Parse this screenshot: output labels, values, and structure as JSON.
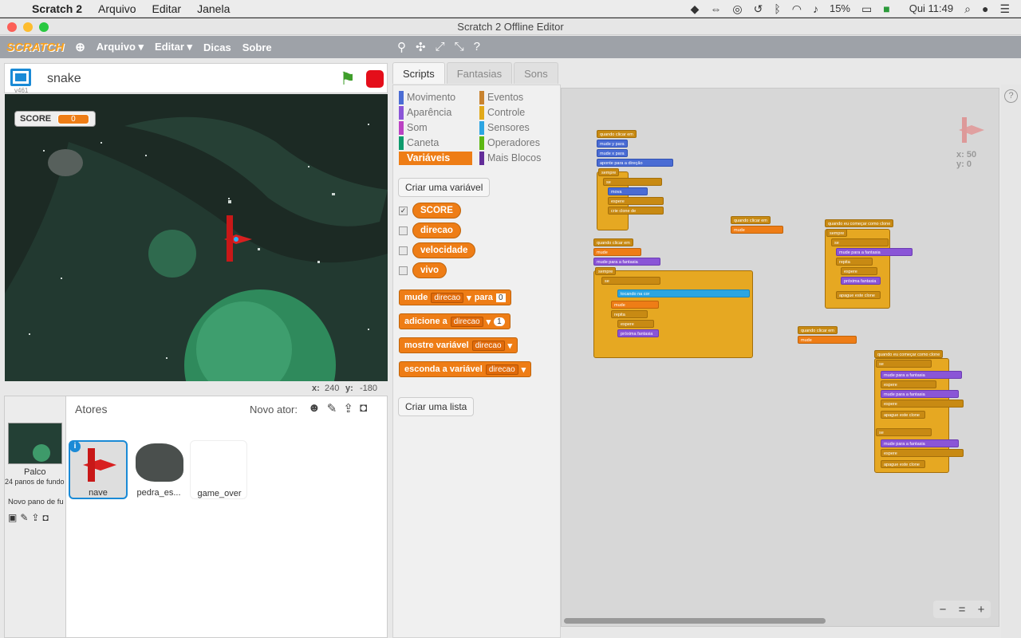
{
  "menubar": {
    "apple": "",
    "app": "Scratch 2",
    "items": [
      "Arquivo",
      "Editar",
      "Janela"
    ],
    "battery": "15%",
    "time": "Qui 11:49"
  },
  "window": {
    "title": "Scratch 2 Offline Editor"
  },
  "toolbar": {
    "logo": "SCRATCH",
    "menus": [
      "Arquivo ▾",
      "Editar ▾",
      "Dicas",
      "Sobre"
    ]
  },
  "stage": {
    "project_name": "snake",
    "version": "v461",
    "score_label": "SCORE",
    "score_value": "0",
    "x_label": "x:",
    "x": "240",
    "y_label": "y:",
    "y": "-180"
  },
  "sprites": {
    "header": "Atores",
    "new_sprite": "Novo ator:",
    "stage_label": "Palco",
    "stage_sub": "24 panos de fundo",
    "new_backdrop": "Novo pano de fu",
    "list": [
      "nave",
      "pedra_es...",
      "game_over"
    ]
  },
  "tabs": [
    "Scripts",
    "Fantasias",
    "Sons"
  ],
  "categories": {
    "left": [
      "Movimento",
      "Aparência",
      "Som",
      "Caneta",
      "Variáveis"
    ],
    "right": [
      "Eventos",
      "Controle",
      "Sensores",
      "Operadores",
      "Mais Blocos"
    ]
  },
  "colors": {
    "movimento": "#4a6cd4",
    "aparencia": "#8a55d7",
    "som": "#bb42c3",
    "caneta": "#0e9a6c",
    "variaveis": "#ee7d16",
    "eventos": "#c88330",
    "controle": "#e1a91a",
    "sensores": "#2ca5e2",
    "operadores": "#5cb712",
    "maisblocos": "#632d99"
  },
  "palette": {
    "create_var": "Criar uma variável",
    "variables": [
      "SCORE",
      "direcao",
      "velocidade",
      "vivo"
    ],
    "create_list": "Criar uma lista",
    "blocks": {
      "set": "mude",
      "set_to": "para",
      "set_val": "0",
      "change": "adicione a",
      "change_val": "1",
      "show": "mostre variável",
      "hide": "esconda a variável",
      "dd": "direcao"
    }
  },
  "sprite_info": {
    "x": "x: 50",
    "y": "y: 0"
  },
  "scripts": {
    "hat": "quando clicar em",
    "clone_hat": "quando eu começar como clone",
    "a": [
      "mude y para",
      "mude x para",
      "aponte para a direção",
      "sempre",
      "se",
      "vivo",
      "então",
      "mova",
      "passos",
      "espere",
      "velocidade",
      "seg",
      "crie clone de"
    ],
    "b": [
      "mude",
      "para",
      "mude para a fantasia",
      "sempre",
      "se",
      "tocando na cor",
      "ou",
      "tocando em",
      "mude",
      "repita",
      "vezes",
      "espere",
      "próxima fantasia"
    ],
    "c": [
      "sempre",
      "se",
      "vivo",
      "então",
      "mude para a fantasia",
      "repita",
      "vezes",
      "espere",
      "próxima fantasia",
      "apague este clone"
    ],
    "d": [
      "se",
      "SCORE",
      "então",
      "mude para a fantasia",
      "espere",
      "velocidade",
      "seg",
      "apague este clone"
    ]
  },
  "zoom": [
    "−",
    "=",
    "+"
  ]
}
